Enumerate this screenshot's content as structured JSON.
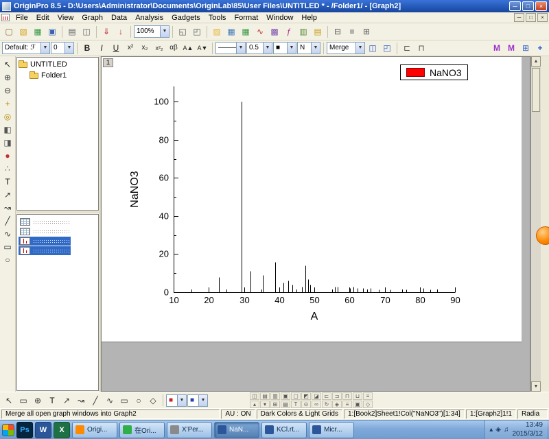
{
  "window": {
    "title": "OriginPro 8.5 - D:\\Users\\Administrator\\Documents\\OriginLab\\85\\User Files\\UNTITLED * - /Folder1/ - [Graph2]",
    "controls": {
      "minimize": "─",
      "maximize": "□",
      "close": "×"
    }
  },
  "menu": {
    "items": [
      "File",
      "Edit",
      "View",
      "Graph",
      "Data",
      "Analysis",
      "Gadgets",
      "Tools",
      "Format",
      "Window",
      "Help"
    ]
  },
  "standard_toolbar": {
    "items": [
      {
        "t": "btn",
        "name": "new-project",
        "g": "▢",
        "c": "#8a6d2f"
      },
      {
        "t": "btn",
        "name": "open",
        "g": "▨",
        "c": "#d8a020"
      },
      {
        "t": "btn",
        "name": "open-excel",
        "g": "▦",
        "c": "#3b9b47"
      },
      {
        "t": "btn",
        "name": "save-project",
        "g": "▣",
        "c": "#3a62b0"
      },
      {
        "t": "sep"
      },
      {
        "t": "btn",
        "name": "print",
        "g": "▤",
        "c": "#666666"
      },
      {
        "t": "btn",
        "name": "print-preview",
        "g": "◫",
        "c": "#666666"
      },
      {
        "t": "sep"
      },
      {
        "t": "btn",
        "name": "import-wizard",
        "g": "⇓",
        "c": "#c03030"
      },
      {
        "t": "btn",
        "name": "import-single-ascii",
        "g": "↓",
        "c": "#c03030"
      },
      {
        "t": "sep"
      },
      {
        "t": "combo",
        "name": "zoom",
        "v": "100%",
        "w": 52
      },
      {
        "t": "sep"
      },
      {
        "t": "btn",
        "name": "rescale-layer",
        "g": "◱",
        "c": "#555555"
      },
      {
        "t": "btn",
        "name": "fit-page",
        "g": "◰",
        "c": "#555555"
      },
      {
        "t": "sep"
      },
      {
        "t": "btn",
        "name": "new-folder",
        "g": "▨",
        "c": "#e8b33a"
      },
      {
        "t": "btn",
        "name": "new-workbook",
        "g": "▦",
        "c": "#4a7ebb"
      },
      {
        "t": "btn",
        "name": "new-excel-workbook",
        "g": "▦",
        "c": "#3b9b47"
      },
      {
        "t": "btn",
        "name": "new-graph",
        "g": "∿",
        "c": "#c03030"
      },
      {
        "t": "btn",
        "name": "new-matrix",
        "g": "▩",
        "c": "#7a4fb0"
      },
      {
        "t": "btn",
        "name": "new-function-plot",
        "g": "ƒ",
        "c": "#b03a8a"
      },
      {
        "t": "btn",
        "name": "new-layout",
        "g": "▥",
        "c": "#5a8a3a"
      },
      {
        "t": "btn",
        "name": "new-notes",
        "g": "▤",
        "c": "#c8a020"
      },
      {
        "t": "sep"
      },
      {
        "t": "btn",
        "name": "project-explorer-toggle",
        "g": "⊟",
        "c": "#555555"
      },
      {
        "t": "btn",
        "name": "results-log-toggle",
        "g": "≡",
        "c": "#555555"
      },
      {
        "t": "btn",
        "name": "command-window-toggle",
        "g": "⊞",
        "c": "#555555"
      }
    ]
  },
  "format_toolbar": {
    "items": [
      {
        "t": "combo",
        "name": "font-preset",
        "v": "Default: ℱ",
        "w": 70
      },
      {
        "t": "combo",
        "name": "font-size",
        "v": "0",
        "w": 34
      },
      {
        "t": "sep"
      },
      {
        "t": "btn",
        "name": "bold",
        "g": "B",
        "c": "#222222",
        "bold": true
      },
      {
        "t": "btn",
        "name": "italic",
        "g": "I",
        "c": "#222222",
        "italic": true
      },
      {
        "t": "btn",
        "name": "underline",
        "g": "U",
        "c": "#222222",
        "underline": true
      },
      {
        "t": "btn",
        "name": "superscript",
        "g": "x²",
        "c": "#222222",
        "fs": 10
      },
      {
        "t": "btn",
        "name": "subscript",
        "g": "x₂",
        "c": "#222222",
        "fs": 10
      },
      {
        "t": "btn",
        "name": "super-subscript",
        "g": "x²₂",
        "c": "#222222",
        "fs": 9
      },
      {
        "t": "btn",
        "name": "greek-symbols",
        "g": "αβ",
        "c": "#222222",
        "fs": 10
      },
      {
        "t": "btn",
        "name": "increase-font-size",
        "g": "A▲",
        "c": "#222222",
        "fs": 9
      },
      {
        "t": "btn",
        "name": "decrease-font-size",
        "g": "A▼",
        "c": "#222222",
        "fs": 9
      },
      {
        "t": "sep"
      },
      {
        "t": "combo",
        "name": "line-style",
        "v": "———",
        "w": 44
      },
      {
        "t": "combo",
        "name": "line-width",
        "v": "0.5",
        "w": 38
      },
      {
        "t": "combo",
        "name": "stroke-color",
        "v": "■",
        "vc": "#000000",
        "w": 34
      },
      {
        "t": "combo",
        "name": "fill-color",
        "v": "N",
        "w": 34
      },
      {
        "t": "sep"
      },
      {
        "t": "combo",
        "name": "merge",
        "v": "Merge",
        "w": 56
      },
      {
        "t": "btn",
        "name": "merge-on-page",
        "g": "◫",
        "c": "#2f5fc9"
      },
      {
        "t": "btn",
        "name": "extract-layer",
        "g": "◰",
        "c": "#2f5fc9"
      },
      {
        "t": "sep"
      },
      {
        "t": "btn",
        "name": "align-left-layers",
        "g": "⊏",
        "c": "#555555"
      },
      {
        "t": "btn",
        "name": "align-top-layers",
        "g": "⊓",
        "c": "#555555"
      },
      {
        "t": "gap"
      },
      {
        "t": "btn",
        "name": "merge-all-graph-windows",
        "g": "M",
        "c": "#9b30c9",
        "bold": true
      },
      {
        "t": "btn",
        "name": "merge-selected-graph-windows",
        "g": "M",
        "c": "#9b30c9",
        "bold": true
      },
      {
        "t": "btn",
        "name": "new-layer",
        "g": "⊞",
        "c": "#2f5fc9"
      },
      {
        "t": "btn",
        "name": "layer-management",
        "g": "+",
        "c": "#2f5fc9",
        "bold": true
      }
    ]
  },
  "tools_toolbar": {
    "items": [
      {
        "name": "pointer-tool",
        "g": "↖",
        "c": "#222222"
      },
      {
        "name": "zoom-in-tool",
        "g": "⊕",
        "c": "#333333"
      },
      {
        "name": "zoom-out-tool",
        "g": "⊖",
        "c": "#333333"
      },
      {
        "name": "screen-reader-tool",
        "g": "+",
        "c": "#b08a00"
      },
      {
        "name": "data-reader-tool",
        "g": "◎",
        "c": "#b08a00"
      },
      {
        "name": "data-selector-tool",
        "g": "◧",
        "c": "#555555"
      },
      {
        "name": "selection-on-active-plot-tool",
        "g": "◨",
        "c": "#555555"
      },
      {
        "name": "mask-range-tool",
        "g": "●",
        "c": "#c03030"
      },
      {
        "name": "draw-data-tool",
        "g": "∴",
        "c": "#555555"
      },
      {
        "name": "text-tool",
        "g": "T",
        "c": "#111111"
      },
      {
        "name": "arrow-tool",
        "g": "↗",
        "c": "#333333"
      },
      {
        "name": "curved-arrow-tool",
        "g": "↝",
        "c": "#333333"
      },
      {
        "name": "line-tool",
        "g": "╱",
        "c": "#333333"
      },
      {
        "name": "polyline-tool",
        "g": "∿",
        "c": "#333333"
      },
      {
        "name": "rectangle-tool",
        "g": "▭",
        "c": "#333333"
      },
      {
        "name": "ellipse-tool",
        "g": "○",
        "c": "#333333"
      }
    ]
  },
  "project_explorer": {
    "root": "UNTITLED",
    "folder": "Folder1"
  },
  "window_panel": {
    "items": [
      {
        "kind": "workbook",
        "selected": false
      },
      {
        "kind": "workbook",
        "selected": false
      },
      {
        "kind": "graph",
        "selected": true
      },
      {
        "kind": "graph",
        "selected": true
      }
    ]
  },
  "graph": {
    "layer_badge": "1"
  },
  "chart_data": {
    "type": "bar",
    "plot_style": "vertical-drop-lines",
    "title": "",
    "xlabel": "A",
    "ylabel": "NaNO3",
    "xlim": [
      10,
      90
    ],
    "ylim": [
      0,
      108
    ],
    "x_ticks": [
      10,
      20,
      30,
      40,
      50,
      60,
      70,
      80,
      90
    ],
    "y_ticks": [
      0,
      20,
      40,
      60,
      80,
      100
    ],
    "x_minor_step": 5,
    "y_minor_step": 10,
    "grid": false,
    "legend": {
      "label": "NaNO3",
      "color": "#ff0000",
      "position": "top-right"
    },
    "series": [
      {
        "name": "NaNO3",
        "color": "#000000",
        "points": [
          {
            "x": 22.9,
            "y": 8
          },
          {
            "x": 29.4,
            "y": 100
          },
          {
            "x": 31.9,
            "y": 11
          },
          {
            "x": 35.4,
            "y": 9
          },
          {
            "x": 38.9,
            "y": 16
          },
          {
            "x": 41.2,
            "y": 5
          },
          {
            "x": 42.5,
            "y": 6
          },
          {
            "x": 43.8,
            "y": 4
          },
          {
            "x": 46.5,
            "y": 3
          },
          {
            "x": 47.5,
            "y": 14
          },
          {
            "x": 48.3,
            "y": 7
          },
          {
            "x": 48.9,
            "y": 4
          },
          {
            "x": 55.8,
            "y": 3
          },
          {
            "x": 56.7,
            "y": 3
          },
          {
            "x": 60.2,
            "y": 2
          },
          {
            "x": 61.1,
            "y": 3
          },
          {
            "x": 62.3,
            "y": 2
          },
          {
            "x": 63.9,
            "y": 2
          },
          {
            "x": 66.0,
            "y": 2
          },
          {
            "x": 68.3,
            "y": 1.5
          },
          {
            "x": 71.6,
            "y": 1.5
          },
          {
            "x": 76.2,
            "y": 1.5
          },
          {
            "x": 81.0,
            "y": 2
          },
          {
            "x": 82.9,
            "y": 1.5
          }
        ]
      }
    ]
  },
  "bottom_toolbar": {
    "left_items": [
      {
        "t": "btn",
        "name": "pointer-tool",
        "g": "↖",
        "c": "#333333"
      },
      {
        "t": "btn",
        "name": "region-select-tool",
        "g": "▭",
        "c": "#333333"
      },
      {
        "t": "btn",
        "name": "zoom-tool",
        "g": "⊕",
        "c": "#333333"
      },
      {
        "t": "btn",
        "name": "text-annotation-tool",
        "g": "T",
        "c": "#111111"
      },
      {
        "t": "btn",
        "name": "arrow-annotation-tool",
        "g": "↗",
        "c": "#333333"
      },
      {
        "t": "btn",
        "name": "curved-arrow-annotation-tool",
        "g": "↝",
        "c": "#333333"
      },
      {
        "t": "btn",
        "name": "line-annotation-tool",
        "g": "╱",
        "c": "#333333"
      },
      {
        "t": "btn",
        "name": "polyline-annotation-tool",
        "g": "∿",
        "c": "#333333"
      },
      {
        "t": "btn",
        "name": "rectangle-annotation-tool",
        "g": "▭",
        "c": "#333333"
      },
      {
        "t": "btn",
        "name": "ellipse-annotation-tool",
        "g": "○",
        "c": "#333333"
      },
      {
        "t": "btn",
        "name": "polygon-annotation-tool",
        "g": "◇",
        "c": "#333333"
      },
      {
        "t": "sep"
      },
      {
        "t": "combo",
        "name": "object-fill-color",
        "v": "■",
        "vc": "#cc2020",
        "w": 30
      },
      {
        "t": "combo",
        "name": "object-line-color",
        "v": "■",
        "vc": "#2040c0",
        "w": 30
      }
    ],
    "row_a": [
      {
        "name": "duplicate-object",
        "g": "◫"
      },
      {
        "name": "copy-format",
        "g": "▤"
      },
      {
        "name": "paste-format",
        "g": "▥"
      },
      {
        "name": "group-objects",
        "g": "▣"
      },
      {
        "name": "ungroup-objects",
        "g": "▢"
      },
      {
        "name": "bring-to-front",
        "g": "◩"
      },
      {
        "name": "send-to-back",
        "g": "◪"
      },
      {
        "name": "align-left",
        "g": "⊏"
      },
      {
        "name": "align-right",
        "g": "⊐"
      },
      {
        "name": "align-top",
        "g": "⊓"
      },
      {
        "name": "align-bottom",
        "g": "⊔"
      },
      {
        "name": "distribute-objects",
        "g": "≡"
      }
    ],
    "row_b": [
      {
        "name": "layer-up",
        "g": "▴"
      },
      {
        "name": "layer-down",
        "g": "▾"
      },
      {
        "name": "add-axis",
        "g": "⊞"
      },
      {
        "name": "add-legend",
        "g": "▤"
      },
      {
        "name": "add-text",
        "g": "T"
      },
      {
        "name": "add-date-time",
        "g": "⊙"
      },
      {
        "name": "insert-link",
        "g": "∞"
      },
      {
        "name": "update-legend",
        "g": "↻"
      },
      {
        "name": "lock-position",
        "g": "◈"
      },
      {
        "name": "more-tools",
        "g": "≡"
      },
      {
        "name": "object-properties",
        "g": "▣"
      },
      {
        "name": "object-settings",
        "g": "◇"
      }
    ]
  },
  "status_bar": {
    "hint": "Merge all open graph windows into Graph2",
    "au": "AU : ON",
    "theme": "Dark Colors & Light Grids",
    "selection": "1:[Book2]Sheet1!Col(\"NaNO3\")[1:34]",
    "graph_ref": "1:[Graph2]1!1",
    "extra": "Radia"
  },
  "taskbar": {
    "quick_launch": [
      {
        "name": "photoshop",
        "label": "Ps",
        "bg": "#05263f",
        "fg": "#31a8ff"
      },
      {
        "name": "word",
        "label": "W",
        "bg": "#2b579a",
        "fg": "#ffffff"
      },
      {
        "name": "excel",
        "label": "X",
        "bg": "#1e7145",
        "fg": "#ffffff"
      }
    ],
    "apps": [
      {
        "name": "origin",
        "label": "Origi...",
        "icon_color": "#ff8a00",
        "active": false
      },
      {
        "name": "chat-origin",
        "label": "在Ori...",
        "icon_color": "#2fae4a",
        "active": false
      },
      {
        "name": "xpert",
        "label": "X'Per...",
        "icon_color": "#8a8a8a",
        "active": false
      },
      {
        "name": "word-nano3",
        "label": "NaN...",
        "icon_color": "#2b579a",
        "active": true
      },
      {
        "name": "word-kcl",
        "label": "KCl.rt...",
        "icon_color": "#2b579a",
        "active": false
      },
      {
        "name": "word-micr",
        "label": "Micr...",
        "icon_color": "#2b579a",
        "active": false
      }
    ],
    "tray": {
      "icons": [
        {
          "name": "hidden-icons",
          "g": "▴"
        },
        {
          "name": "network",
          "g": "◈"
        },
        {
          "name": "volume",
          "g": "♫"
        }
      ],
      "time": "13:49",
      "date": "2015/3/12"
    }
  }
}
